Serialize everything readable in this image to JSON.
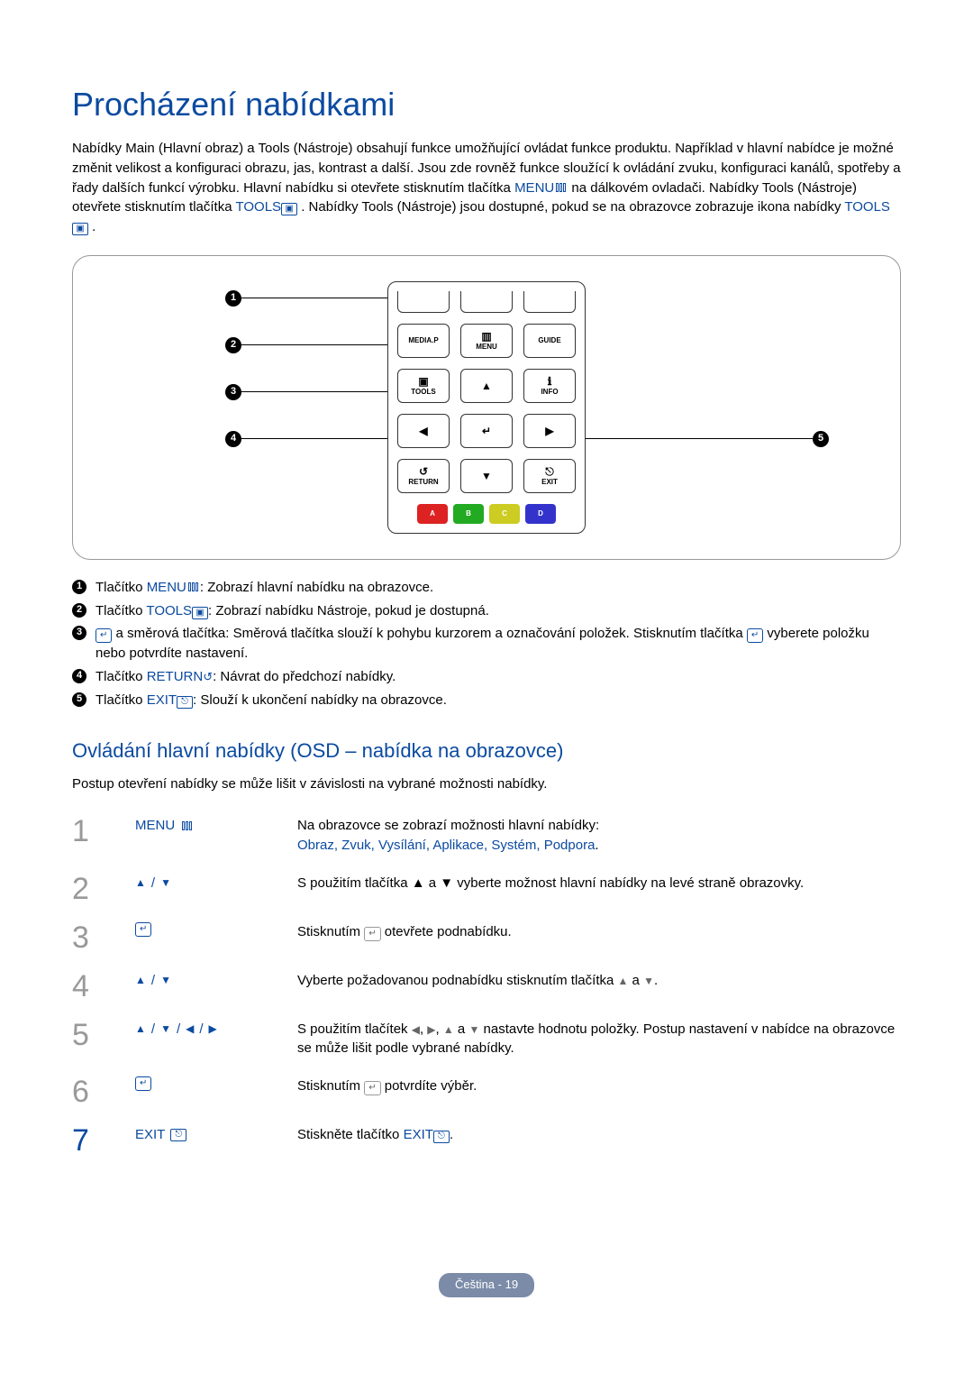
{
  "title": "Procházení nabídkami",
  "intro_parts": {
    "p1": "Nabídky Main (Hlavní obraz) a Tools (Nástroje) obsahují funkce umožňující ovládat funkce produktu. Například v hlavní nabídce je možné změnit velikost a konfiguraci obrazu, jas, kontrast a další. Jsou zde rovněž funkce sloužící k ovládání zvuku, konfiguraci kanálů, spotřeby a řady dalších funkcí výrobku. Hlavní nabídku si otevřete stisknutím tlačítka ",
    "menu": "MENU",
    "p2": " na dálkovém ovladači. Nabídky Tools (Nástroje) otevřete stisknutím tlačítka ",
    "tools": "TOOLS",
    "p3": ". Nabídky Tools (Nástroje) jsou dostupné, pokud se na obrazovce zobrazuje ikona nabídky ",
    "tools2": "TOOLS",
    "p4": "."
  },
  "remote_labels": {
    "mediap": "MEDIA.P",
    "menu": "MENU",
    "guide": "GUIDE",
    "tools": "TOOLS",
    "info": "INFO",
    "return": "RETURN",
    "exit": "EXIT",
    "a": "A",
    "b": "B",
    "c": "C",
    "d": "D"
  },
  "callouts": [
    "1",
    "2",
    "3",
    "4",
    "5"
  ],
  "legend": [
    {
      "n": "1",
      "pre": "Tlačítko ",
      "kw": "MENU",
      "post": ": Zobrazí hlavní nabídku na obrazovce."
    },
    {
      "n": "2",
      "pre": "Tlačítko ",
      "kw": "TOOLS",
      "post": ": Zobrazí nabídku Nástroje, pokud je dostupná."
    },
    {
      "n": "3",
      "pre": "",
      "kw": "",
      "post": " a směrová tlačítka: Směrová tlačítka slouží k pohybu kurzorem a označování položek. Stisknutím tlačítka ",
      "post2": " vyberete položku nebo potvrdíte nastavení.",
      "enter": true
    },
    {
      "n": "4",
      "pre": "Tlačítko ",
      "kw": "RETURN",
      "post": ": Návrat do předchozí nabídky."
    },
    {
      "n": "5",
      "pre": "Tlačítko ",
      "kw": "EXIT",
      "post": ": Slouží k ukončení nabídky na obrazovce."
    }
  ],
  "section2_title": "Ovládání hlavní nabídky (OSD – nabídka na obrazovce)",
  "section2_intro": "Postup otevření nabídky se může lišit v závislosti na vybrané možnosti nabídky.",
  "steps": [
    {
      "num": "1",
      "key": "MENU",
      "desc_pre": "Na obrazovce se zobrazí možnosti hlavní nabídky:",
      "options": "Obraz, Zvuk, Vysílání, Aplikace, Systém, Podpora",
      "options_sep": "."
    },
    {
      "num": "2",
      "key": "▲ / ▼",
      "desc": "S použitím tlačítka ▲ a ▼ vyberte možnost hlavní nabídky na levé straně obrazovky."
    },
    {
      "num": "3",
      "key": "ENTER",
      "desc": "Stisknutím  ↵  otevřete podnabídku."
    },
    {
      "num": "4",
      "key": "▲ / ▼",
      "desc": "Vyberte požadovanou podnabídku stisknutím tlačítka ▲ a ▼."
    },
    {
      "num": "5",
      "key": "▲ / ▼ / ◀ / ▶",
      "desc": "S použitím tlačítek ◀, ▶, ▲ a ▼ nastavte hodnotu položky. Postup nastavení v nabídce na obrazovce se může lišit podle vybrané nabídky."
    },
    {
      "num": "6",
      "key": "ENTER",
      "desc": "Stisknutím  ↵  potvrdíte výběr."
    },
    {
      "num": "7",
      "key": "EXIT",
      "desc_pre": "Stiskněte tlačítko ",
      "kw": "EXIT",
      "desc_post": "."
    }
  ],
  "footer": "Čeština - 19"
}
